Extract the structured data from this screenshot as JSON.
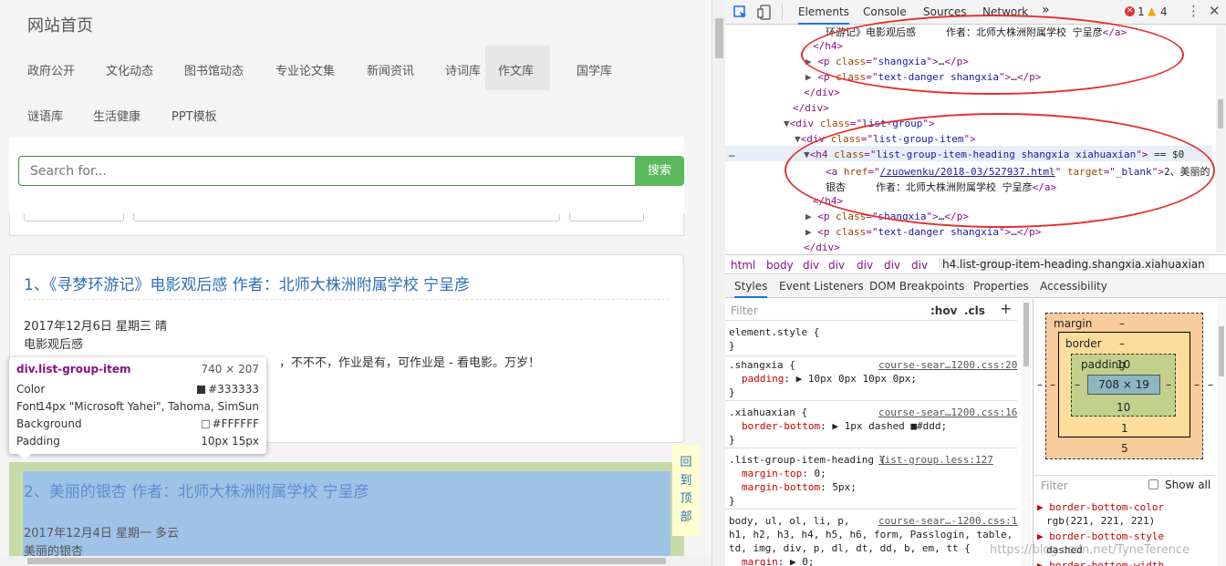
{
  "site": {
    "title": "网站首页",
    "nav_row1": [
      "政府公开",
      "文化动态",
      "图书馆动态",
      "专业论文集",
      "新闻资讯",
      "诗词库",
      "作文库",
      "国学库"
    ],
    "nav_row2": [
      "谜语库",
      "生活健康",
      "PPT模板"
    ],
    "active_nav": "作文库",
    "search_placeholder": "Search for...",
    "search_button": "搜索",
    "article1": {
      "heading": "1、《寻梦环游记》电影观后感 作者：北师大株洲附属学校 宁呈彦",
      "date": "2017年12月6日 星期三 晴",
      "subtitle": "电影观后感",
      "body": "，不不不，作业是有，可作业是 - 看电影。万岁！"
    },
    "article2": {
      "heading": "2、美丽的银杏 作者：北师大株洲附属学校 宁呈彦",
      "date": "2017年12月4日 星期一 多云",
      "subtitle": "美丽的银杏"
    },
    "back_to_top": [
      "回",
      "到",
      "顶",
      "部"
    ]
  },
  "tooltip": {
    "selector": "div.list-group-item",
    "size": "740 × 207",
    "color_label": "Color",
    "color_value": "#333333",
    "font_label": "Font",
    "font_value": "14px \"Microsoft Yahei\", Tahoma, SimSun",
    "bg_label": "Background",
    "bg_value": "#FFFFFF",
    "padding_label": "Padding",
    "padding_value": "10px 15px"
  },
  "devtools": {
    "tabs": [
      "Elements",
      "Console",
      "Sources",
      "Network"
    ],
    "active_tab": "Elements",
    "more": "»",
    "errors": "1",
    "warnings": "4",
    "dom_lines": [
      {
        "indent": 110,
        "html": "<span class='tx'>环游记》电影观后感　　　作者：北师大株洲附属学校 宁呈彦</span>&lt;/a&gt;"
      },
      {
        "indent": 96,
        "html": "&lt;/h4&gt;"
      },
      {
        "indent": 88,
        "html": "<span class='tri'>▶</span> &lt;p <span class='an'>class</span>=\"<span class='av'>shangxia</span>\"&gt;<span class='tx'>…</span>&lt;/p&gt;"
      },
      {
        "indent": 88,
        "html": "<span class='tri'>▶</span> &lt;p <span class='an'>class</span>=\"<span class='av'>text-danger shangxia</span>\"&gt;<span class='tx'>…</span>&lt;/p&gt;"
      },
      {
        "indent": 86,
        "html": "&lt;/div&gt;"
      },
      {
        "indent": 74,
        "html": "&lt;/div&gt;"
      },
      {
        "indent": 64,
        "html": "<span class='tri'>▼</span>&lt;div <span class='an'>class</span>=\"<span class='av'>list-group</span>\"&gt;"
      },
      {
        "indent": 76,
        "html": "<span class='tri'>▼</span>&lt;div <span class='an'>class</span>=\"<span class='av'>list-group-item</span>\"&gt;"
      },
      {
        "indent": 86,
        "html": "<span class='tri'>▼</span>&lt;h4 <span class='an'>class</span>=\"<span class='av'>list-group-item-heading shangxia xiahuaxian</span>\"&gt; <span class='tx'>== $0</span>"
      },
      {
        "indent": 110,
        "html": "&lt;a <span class='an'>href</span>=\"<span class='av' style='text-decoration:underline'>/zuowenku/2018-03/527937.html</span>\" <span class='an'>target</span>=\"<span class='av'>_blank</span>\"&gt;<span class='tx'>2、美丽的</span>"
      },
      {
        "indent": 110,
        "html": "<span class='tx'>银杏　　　作者：北师大株洲附属学校 宁呈彦</span>&lt;/a&gt;"
      },
      {
        "indent": 96,
        "html": "&lt;/h4&gt;"
      },
      {
        "indent": 88,
        "html": "<span class='tri'>▶</span> &lt;p <span class='an'>class</span>=\"<span class='av'>shangxia</span>\"&gt;<span class='tx'>…</span>&lt;/p&gt;"
      },
      {
        "indent": 88,
        "html": "<span class='tri'>▶</span> &lt;p <span class='an'>class</span>=\"<span class='av'>text-danger shangxia</span>\"&gt;<span class='tx'>…</span>&lt;/p&gt;"
      },
      {
        "indent": 86,
        "html": "&lt;/div&gt;"
      }
    ],
    "ellipsis": "…",
    "breadcrumbs": [
      "html",
      "body",
      "div",
      "div",
      "div",
      "div",
      "div",
      "h4.list-group-item-heading.shangxia.xiahuaxian"
    ],
    "subtabs": [
      "Styles",
      "Event Listeners",
      "DOM Breakpoints",
      "Properties",
      "Accessibility"
    ],
    "active_subtab": "Styles",
    "filter_placeholder": "Filter",
    "hov": ":hov",
    "cls": ".cls",
    "plus": "+",
    "element_style": "element.style {",
    "rules": [
      {
        "selector": ".shangxia {",
        "source": "course-sear…1200.css:20",
        "props": [
          [
            "padding",
            "▶ 10px 0px 10px 0px;"
          ]
        ]
      },
      {
        "selector": ".xiahuaxian {",
        "source": "course-sear…1200.css:16",
        "props": [
          [
            "border-bottom",
            "▶ 1px dashed ■#ddd;"
          ]
        ]
      },
      {
        "selector": ".list-group-item-heading {",
        "source": "list-group.less:127",
        "props": [
          [
            "margin-top",
            "0;"
          ],
          [
            "margin-bottom",
            "5px;"
          ]
        ]
      },
      {
        "selector": "body, ul, ol, li, p,",
        "source": "course-sear…-1200.css:1",
        "props": []
      }
    ],
    "rule4_lines": [
      "h1, h2, h3, h4, h5, h6, form, Passlogin, table,",
      "td, img, div, p, dl, dt, dd, b, em, tt {"
    ],
    "rule4_prop": [
      "margin",
      "▶ 0;"
    ],
    "close_brace": "}",
    "boxmodel": {
      "margin_label": "margin",
      "margin_val": "–",
      "border_label": "border",
      "border_val": "–",
      "padding_label": "padding",
      "padding_top": "10",
      "padding_bottom": "10",
      "content": "708 × 19",
      "border_bottom": "1",
      "margin_bottom": "5",
      "side": "–"
    },
    "computed_filter": "Filter",
    "show_all": "Show all",
    "computed": [
      {
        "name": "border-bottom-color",
        "value": "rgb(221, 221, 221)"
      },
      {
        "name": "border-bottom-style",
        "value": "dashed"
      },
      {
        "name": "border-bottom-width",
        "value": ""
      }
    ]
  },
  "watermark": "https://blog.csdn.net/TyneTerence",
  "colors": {
    "link": "#2f6eb5",
    "search_green": "#5cb85c",
    "annotation_red": "#e53030",
    "highlight_blue": "#9fc3e7",
    "highlight_green": "#c7dba9"
  }
}
